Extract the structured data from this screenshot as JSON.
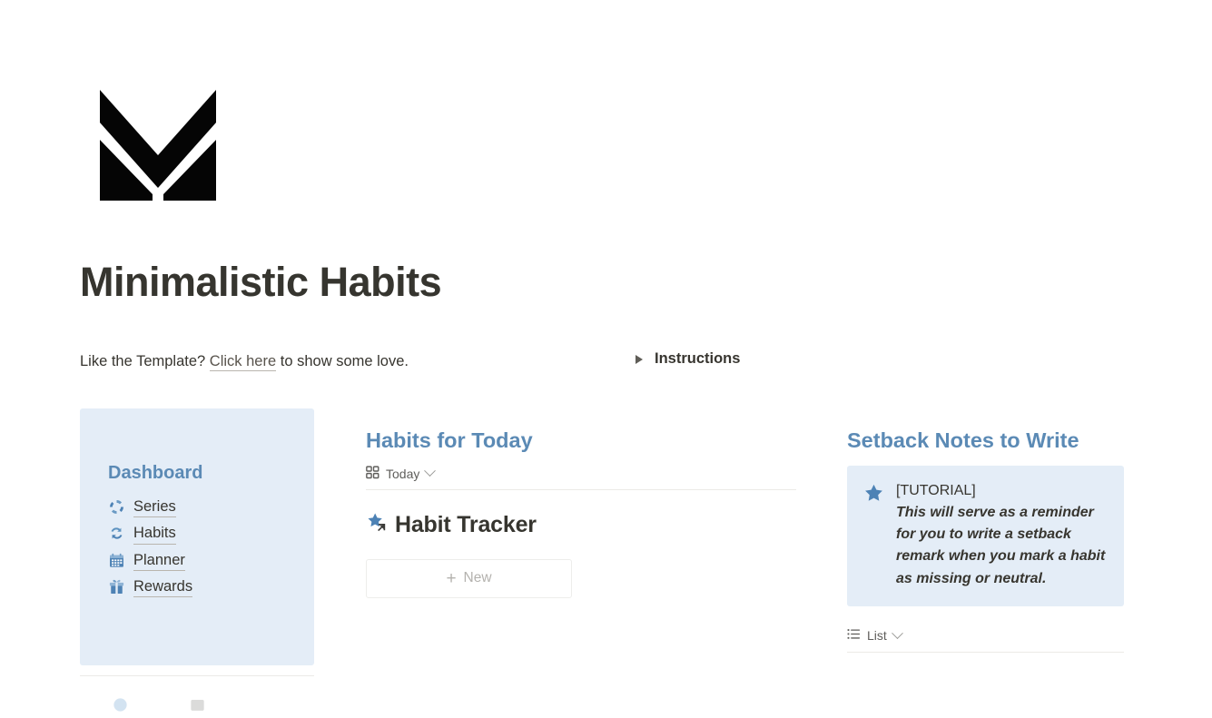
{
  "logo": {
    "name": "minimalistic-habits-logo"
  },
  "header": {
    "title": "Minimalistic Habits",
    "subline_before": "Like the Template? ",
    "subline_link": "Click here",
    "subline_after": " to show some love."
  },
  "instructions": {
    "label": "Instructions",
    "toggle_icon": "triangle-right-icon",
    "expanded": false
  },
  "sidebar": {
    "heading": "Dashboard",
    "items": [
      {
        "label": "Series",
        "icon": "circular-arrows-icon"
      },
      {
        "label": "Habits",
        "icon": "sync-arrows-icon"
      },
      {
        "label": "Planner",
        "icon": "calendar-icon"
      },
      {
        "label": "Rewards",
        "icon": "gift-icon"
      }
    ]
  },
  "habits_today": {
    "heading": "Habits for Today",
    "view": {
      "icon": "gallery-grid-icon",
      "label": "Today",
      "chevron": "chevron-down-icon"
    },
    "database": {
      "icon": "star-link-icon",
      "title": "Habit Tracker"
    },
    "new_button": {
      "plus": "+",
      "label": "New"
    }
  },
  "setback_notes": {
    "heading": "Setback Notes to Write",
    "card": {
      "icon": "star-icon",
      "tag": "[TUTORIAL]",
      "text": "This will serve as a reminder for you to write a setback remark when you mark a habit as missing or neutral."
    },
    "view": {
      "icon": "list-view-icon",
      "label": "List",
      "chevron": "chevron-down-icon"
    }
  },
  "colors": {
    "accent_blue": "#5b8ab5",
    "panel_blue": "#e4edf7",
    "text": "#37352f",
    "muted": "#9b9a97"
  }
}
